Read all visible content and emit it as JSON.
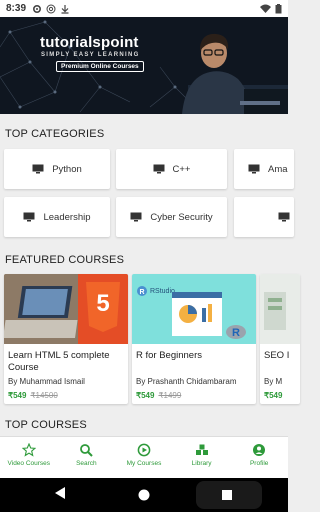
{
  "status_bar": {
    "time": "8:39",
    "icons": [
      "gear-icon",
      "at-icon",
      "download-icon",
      "wifi-icon",
      "battery-icon"
    ]
  },
  "banner": {
    "brand": "tutorialspoint",
    "tagline": "SIMPLY EASY LEARNING",
    "badge": "Premium Online Courses"
  },
  "sections": {
    "top_categories": "TOP CATEGORIES",
    "featured_courses": "FEATURED COURSES",
    "top_courses": "TOP COURSES"
  },
  "categories": [
    {
      "label": "Python",
      "icon": "monitor-icon"
    },
    {
      "label": "C++",
      "icon": "monitor-icon"
    },
    {
      "label": "Ama",
      "icon": "monitor-icon"
    },
    {
      "label": "Leadership",
      "icon": "monitor-icon"
    },
    {
      "label": "Cyber Security",
      "icon": "monitor-icon"
    },
    {
      "label": "",
      "icon": "monitor-icon"
    }
  ],
  "featured": [
    {
      "title": "Learn HTML 5 complete Course",
      "author": "By  Muhammad Ismail",
      "price": "₹549",
      "old_price": "₹14500"
    },
    {
      "title": "R for Beginners",
      "author": "By  Prashanth Chidambaram",
      "price": "₹549",
      "old_price": "₹1499"
    },
    {
      "title": "SEO I",
      "author": "By  M",
      "price": "₹549",
      "old_price": ""
    }
  ],
  "thumb_text": {
    "rstudio": "RStudio",
    "r_logo": "R"
  },
  "bottom_nav": [
    {
      "label": "Video Courses",
      "icon": "star-icon"
    },
    {
      "label": "Search",
      "icon": "search-icon"
    },
    {
      "label": "My Courses",
      "icon": "play-circle-icon"
    },
    {
      "label": "Library",
      "icon": "library-icon"
    },
    {
      "label": "Profile",
      "icon": "profile-icon"
    }
  ],
  "colors": {
    "accent": "#2e9a3a",
    "banner_bg": "#0f1620",
    "html5_orange": "#e44d26"
  }
}
